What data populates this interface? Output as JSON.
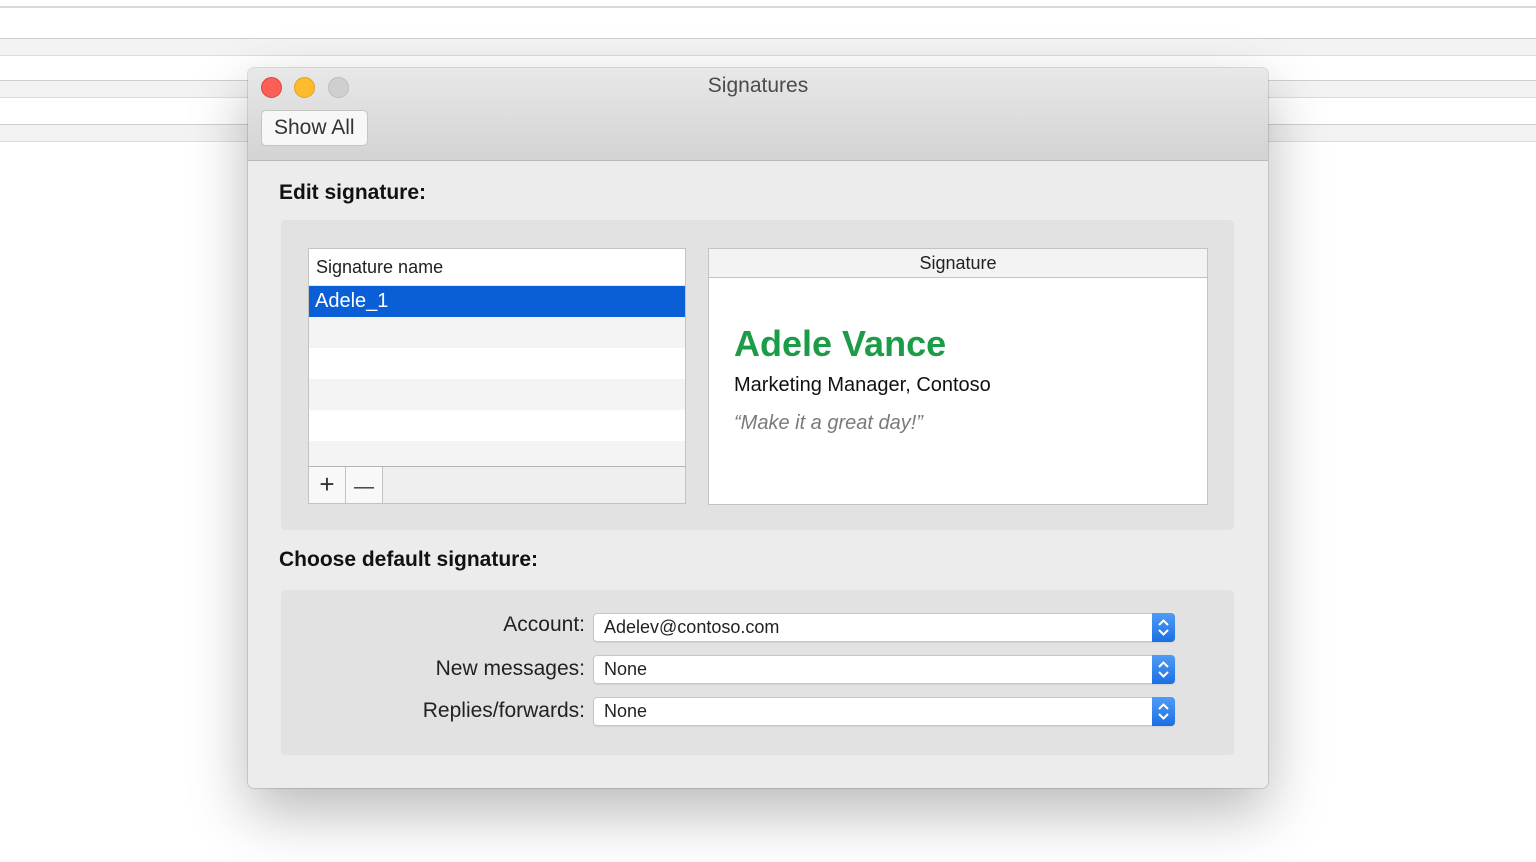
{
  "window": {
    "title": "Signatures"
  },
  "toolbar": {
    "show_all_label": "Show All"
  },
  "edit_section": {
    "title": "Edit signature:"
  },
  "signature_list": {
    "header": "Signature name",
    "items": [
      "Adele_1"
    ],
    "selected_index": 0,
    "add_label": "+",
    "remove_label": "—"
  },
  "signature_preview": {
    "header": "Signature",
    "name": "Adele Vance",
    "role": "Marketing Manager, Contoso",
    "quote": "“Make it a great day!”",
    "name_color": "#1c9c46"
  },
  "default_section": {
    "title": "Choose default signature:",
    "account": {
      "label": "Account:",
      "value": "Adelev@contoso.com"
    },
    "new_messages": {
      "label": "New messages:",
      "value": "None"
    },
    "replies_forwards": {
      "label": "Replies/forwards:",
      "value": "None"
    }
  },
  "colors": {
    "selection": "#0a5fd6",
    "close": "#fc5f57",
    "minimize": "#fdbc2e",
    "stepper": "#1a6fe6"
  },
  "icons": [
    "close-icon",
    "minimize-icon",
    "zoom-icon",
    "plus-icon",
    "minus-icon",
    "updown-chevron-icon"
  ]
}
